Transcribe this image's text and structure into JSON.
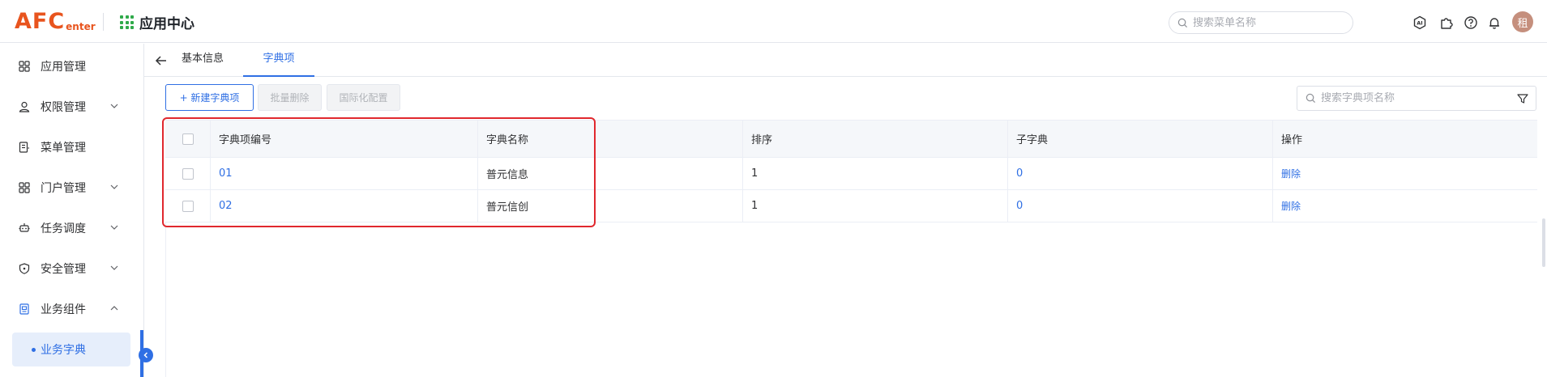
{
  "header": {
    "logo_big": "AFC",
    "logo_small": "enter",
    "app_title": "应用中心",
    "search_placeholder": "搜索菜单名称",
    "icons": [
      "ai-icon",
      "puzzle-icon",
      "help-icon",
      "bell-icon"
    ],
    "avatar_text": "租"
  },
  "sidebar": {
    "items": [
      {
        "label": "应用管理",
        "icon": "grid-icon",
        "expandable": false
      },
      {
        "label": "权限管理",
        "icon": "user-icon",
        "expandable": true
      },
      {
        "label": "菜单管理",
        "icon": "menu-doc-icon",
        "expandable": false
      },
      {
        "label": "门户管理",
        "icon": "grid-icon",
        "expandable": true
      },
      {
        "label": "任务调度",
        "icon": "robot-icon",
        "expandable": true
      },
      {
        "label": "安全管理",
        "icon": "shield-icon",
        "expandable": true
      },
      {
        "label": "业务组件",
        "icon": "component-icon",
        "expandable": true,
        "expanded": true
      }
    ],
    "sub_item": "业务字典"
  },
  "tabs": [
    {
      "label": "基本信息",
      "active": false
    },
    {
      "label": "字典项",
      "active": true
    }
  ],
  "toolbar": {
    "new_label": "+ 新建字典项",
    "batch_delete_label": "批量删除",
    "i18n_label": "国际化配置",
    "search_placeholder": "搜索字典项名称"
  },
  "table": {
    "columns": [
      "字典项编号",
      "字典名称",
      "排序",
      "子字典",
      "操作"
    ],
    "rows": [
      {
        "code": "01",
        "name": "普元信息",
        "sort": "1",
        "sub_dict": "0",
        "action": "删除"
      },
      {
        "code": "02",
        "name": "普元信创",
        "sort": "1",
        "sub_dict": "0",
        "action": "删除"
      }
    ]
  },
  "colors": {
    "accent": "#2f6fe4",
    "logo": "#e8541e",
    "highlight": "#e0282e",
    "app_grid": "#2faa4a"
  }
}
